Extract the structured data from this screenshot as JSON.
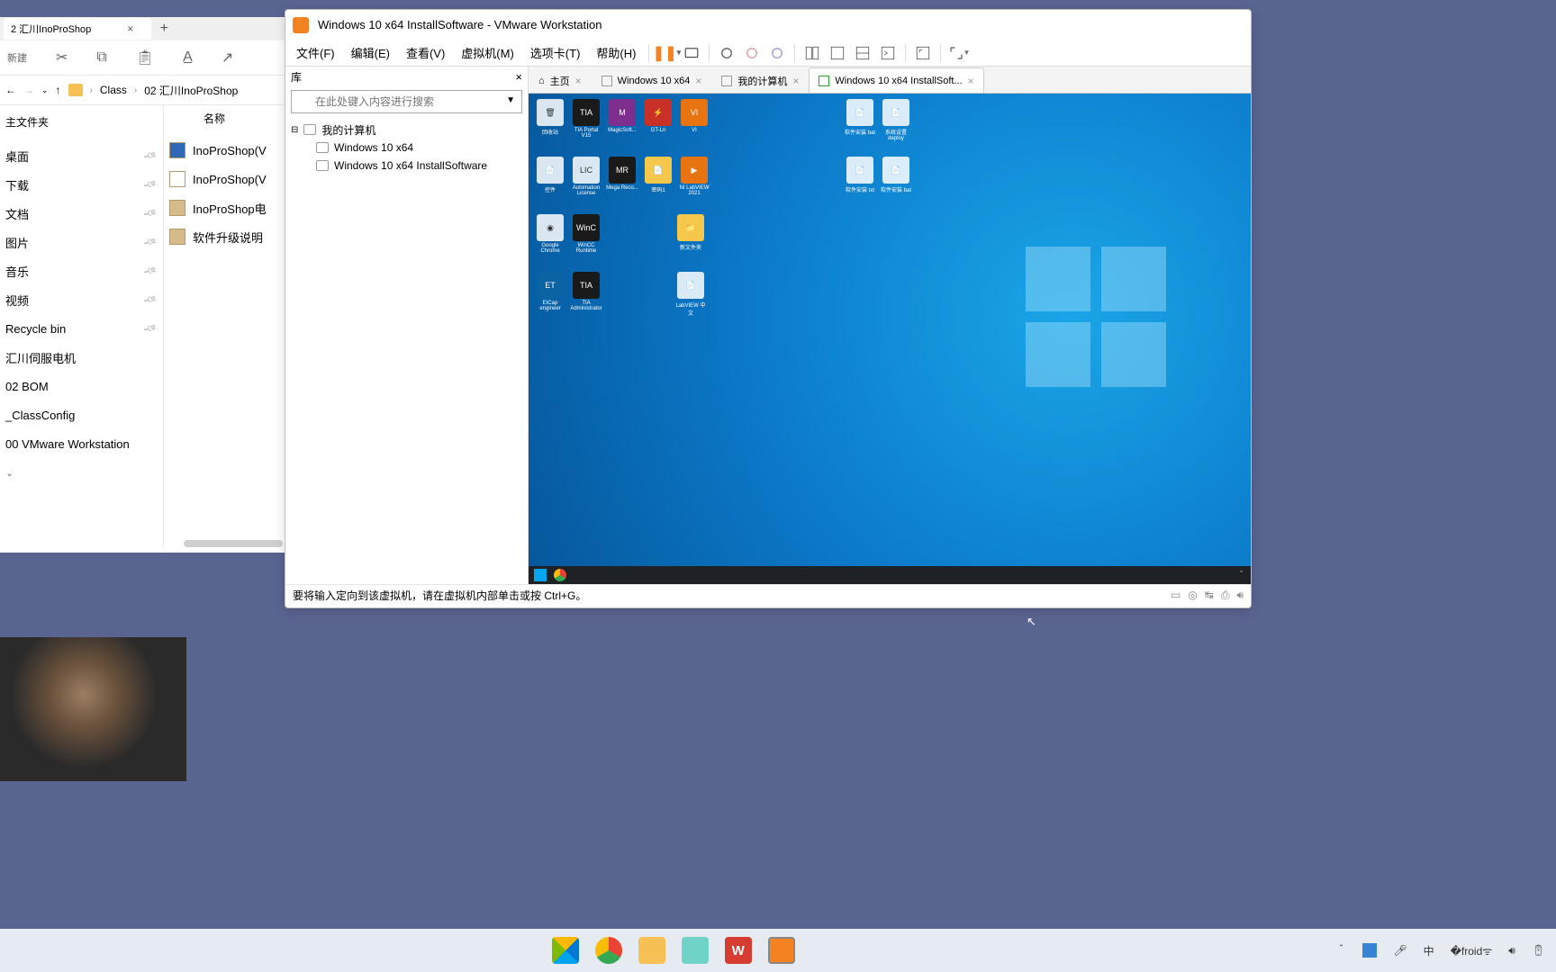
{
  "explorer": {
    "tab_title": "2 汇川InoProShop",
    "newbtn": "新建",
    "breadcrumb": [
      "Class",
      "02 汇川InoProShop"
    ],
    "nav_header": "主文件夹",
    "nav_pinned": [
      "桌面",
      "下载",
      "文档",
      "图片",
      "音乐",
      "视频",
      "Recycle bin"
    ],
    "nav_items": [
      "汇川伺服电机",
      "02 BOM",
      "_ClassConfig",
      "00 VMware Workstation"
    ],
    "col_name": "名称",
    "files": [
      "InoProShop(V",
      "InoProShop(V",
      "InoProShop电",
      "软件升级说明"
    ]
  },
  "vmware": {
    "title": "Windows 10 x64 InstallSoftware - VMware Workstation",
    "menus": [
      "文件(F)",
      "编辑(E)",
      "查看(V)",
      "虚拟机(M)",
      "选项卡(T)",
      "帮助(H)"
    ],
    "sidebar_title": "库",
    "search_placeholder": "在此处键入内容进行搜索",
    "tree_root": "我的计算机",
    "tree_items": [
      "Windows 10 x64",
      "Windows 10 x64 InstallSoftware"
    ],
    "tabs": [
      {
        "label": "主页",
        "icon": "home"
      },
      {
        "label": "Windows 10 x64",
        "icon": "vm"
      },
      {
        "label": "我的计算机",
        "icon": "pc"
      },
      {
        "label": "Windows 10 x64 InstallSoft...",
        "icon": "vm",
        "active": true
      }
    ],
    "guest_icons_row1": [
      {
        "label": "回收站",
        "cls": ""
      },
      {
        "label": "TIA Portal V15",
        "cls": "black"
      },
      {
        "label": "MagicSoft...",
        "cls": "purple"
      },
      {
        "label": "GT-Ln",
        "cls": "red"
      },
      {
        "label": "VI",
        "cls": "orange"
      }
    ],
    "guest_icons_row2": [
      {
        "label": "控件",
        "cls": ""
      },
      {
        "label": "Automation License",
        "cls": ""
      },
      {
        "label": "Mega Reco...",
        "cls": "black"
      },
      {
        "label": "密码1",
        "cls": "yellow"
      },
      {
        "label": "NI LabVIEW 2021",
        "cls": "orange"
      }
    ],
    "guest_icons_row3": [
      {
        "label": "Google Chrome",
        "cls": ""
      },
      {
        "label": "WinCC Runtime",
        "cls": "black"
      }
    ],
    "guest_icons_row4": [
      {
        "label": "EtCap engineer",
        "cls": "blue"
      },
      {
        "label": "TIA Administrator",
        "cls": "black"
      }
    ],
    "guest_icons_col5": [
      {
        "label": "新文件夹",
        "cls": "yellow"
      },
      {
        "label": "LabVIEW 中文",
        "cls": ""
      }
    ],
    "guest_icons_far": [
      {
        "label": "软件安装 bat",
        "cls": ""
      },
      {
        "label": "系统设置 deploy",
        "cls": ""
      },
      {
        "label": "软件安装 txt",
        "cls": ""
      },
      {
        "label": "软件安装 bat",
        "cls": ""
      }
    ],
    "status_text": "要将输入定向到该虚拟机，请在虚拟机内部单击或按 Ctrl+G。"
  },
  "host_tray": {
    "ime": "中"
  }
}
